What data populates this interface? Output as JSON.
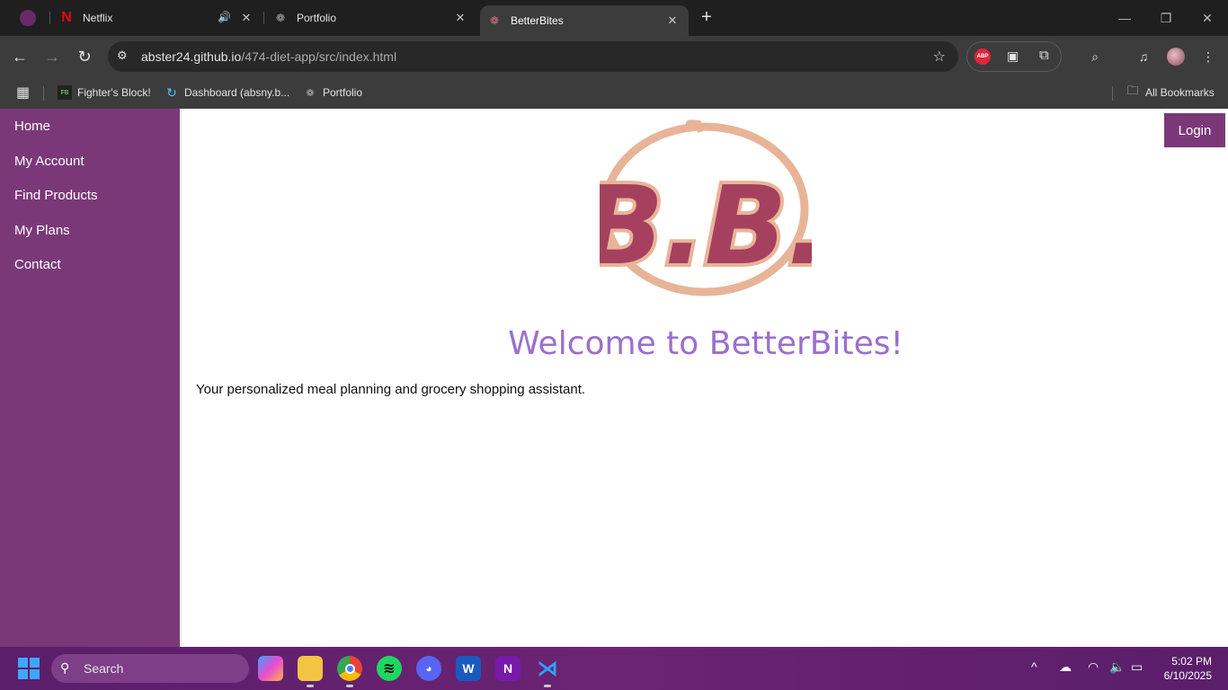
{
  "browser": {
    "tabs": [
      {
        "title": "Netflix",
        "icon": "netflix-icon"
      },
      {
        "title": "Portfolio",
        "icon": "portfolio-icon"
      },
      {
        "title": "BetterBites",
        "icon": "betterbites-icon",
        "active": true
      }
    ],
    "url_host": "abster24.github.io",
    "url_path": "/474-diet-app/src/index.html",
    "bookmarks": [
      {
        "label": "Fighter's Block!",
        "icon": "fighters-block-icon"
      },
      {
        "label": "Dashboard (absny.b...",
        "icon": "dashboard-icon"
      },
      {
        "label": "Portfolio",
        "icon": "portfolio-icon"
      }
    ],
    "all_bookmarks": "All Bookmarks",
    "extension_abp": "ABP"
  },
  "sidebar": {
    "items": [
      {
        "label": "Home"
      },
      {
        "label": "My Account"
      },
      {
        "label": "Find Products"
      },
      {
        "label": "My Plans"
      },
      {
        "label": "Contact"
      }
    ]
  },
  "page": {
    "login_label": "Login",
    "logo_text": "B.B.",
    "welcome": "Welcome to BetterBites!",
    "tagline": "Your personalized meal planning and grocery shopping assistant."
  },
  "taskbar": {
    "search_label": "Search",
    "time": "5:02 PM",
    "date": "6/10/2025"
  },
  "colors": {
    "sidebar": "#7b3879",
    "welcome": "#9b6fcf",
    "logo_ring": "#e8b498",
    "logo_letters": "#a6405f"
  }
}
